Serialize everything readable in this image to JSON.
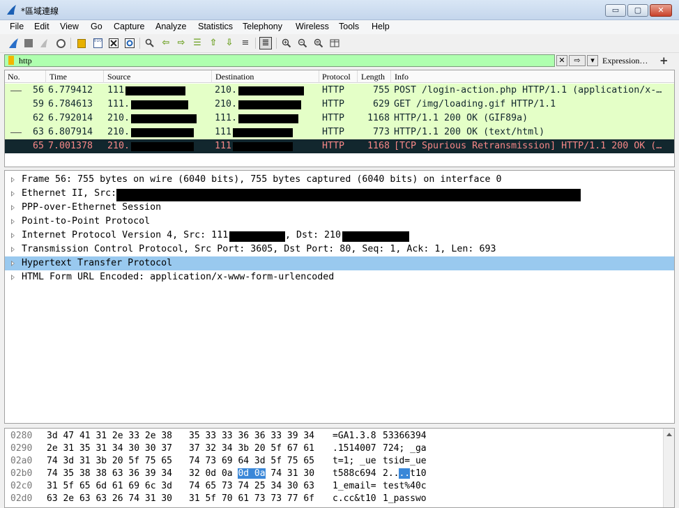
{
  "window": {
    "title": "*區域連線",
    "minimize_label": "▭",
    "maximize_label": "▢",
    "close_label": "✕"
  },
  "menu": [
    "File",
    "Edit",
    "View",
    "Go",
    "Capture",
    "Analyze",
    "Statistics",
    "Telephony",
    "Wireless",
    "Tools",
    "Help"
  ],
  "filter": {
    "value": "http",
    "expression_label": "Expression…",
    "plus_label": "+",
    "clear_label": "✕",
    "apply_label": "⇨",
    "dropdown_label": "▾"
  },
  "packet_list": {
    "columns": [
      "No.",
      "Time",
      "Source",
      "Destination",
      "Protocol",
      "Length",
      "Info"
    ],
    "rows": [
      {
        "no": "56",
        "time": "6.779412",
        "source": "111",
        "destination": "210.",
        "protocol": "HTTP",
        "length": "755",
        "info": "POST /login-action.php HTTP/1.1  (application/x-…",
        "bg": "#e4ffc7",
        "fg": "#12272e"
      },
      {
        "no": "59",
        "time": "6.784613",
        "source": "111.",
        "destination": "210.",
        "protocol": "HTTP",
        "length": "629",
        "info": "GET /img/loading.gif HTTP/1.1",
        "bg": "#e4ffc7",
        "fg": "#12272e"
      },
      {
        "no": "62",
        "time": "6.792014",
        "source": "210.",
        "destination": "111.",
        "protocol": "HTTP",
        "length": "1168",
        "info": "HTTP/1.1 200 OK  (GIF89a)",
        "bg": "#e4ffc7",
        "fg": "#12272e"
      },
      {
        "no": "63",
        "time": "6.807914",
        "source": "210.",
        "destination": "111",
        "protocol": "HTTP",
        "length": "773",
        "info": "HTTP/1.1 200 OK  (text/html)",
        "bg": "#e4ffc7",
        "fg": "#12272e"
      },
      {
        "no": "65",
        "time": "7.001378",
        "source": "210.",
        "destination": "111",
        "protocol": "HTTP",
        "length": "1168",
        "info": "[TCP Spurious Retransmission] HTTP/1.1 200 OK  (…",
        "bg": "#12272e",
        "fg": "#f78787"
      }
    ]
  },
  "details": [
    "Frame 56: 755 bytes on wire (6040 bits), 755 bytes captured (6040 bits) on interface 0",
    "Ethernet II, Src:",
    "PPP-over-Ethernet Session",
    "Point-to-Point Protocol",
    "Internet Protocol Version 4, Src: 111",
    "Transmission Control Protocol, Src Port: 3605, Dst Port: 80, Seq: 1, Ack: 1, Len: 693",
    "Hypertext Transfer Protocol",
    "HTML Form URL Encoded: application/x-www-form-urlencoded"
  ],
  "ipv4_dst_label": ", Dst: 210",
  "bytes": [
    {
      "offset": "0280",
      "hex1": "3d 47 41 31 2e 33 2e 38",
      "hex2": "35 33 33 36 36 33 39 34",
      "ascii1": "=GA1.3.8",
      "ascii2": "53366394"
    },
    {
      "offset": "0290",
      "hex1": "2e 31 35 31 34 30 30 37",
      "hex2": "37 32 34 3b 20 5f 67 61",
      "ascii1": ".1514007",
      "ascii2": "724; _ga"
    },
    {
      "offset": "02a0",
      "hex1": "74 3d 31 3b 20 5f 75 65",
      "hex2": "74 73 69 64 3d 5f 75 65",
      "ascii1": "t=1; _ue",
      "ascii2": "tsid=_ue"
    },
    {
      "offset": "02b0",
      "hex1": "74 35 38 38 63 36 39 34",
      "hex2_a": "32 0d 0a ",
      "hex2_hl": "0d 0a",
      "hex2_b": " 74 31 30",
      "ascii1": "t588c694",
      "ascii2_a": "2..",
      "ascii2_hl": "..",
      "ascii2_b": "t10"
    },
    {
      "offset": "02c0",
      "hex1": "31 5f 65 6d 61 69 6c 3d",
      "hex2": "74 65 73 74 25 34 30 63",
      "ascii1": "1_email=",
      "ascii2": "test%40c"
    },
    {
      "offset": "02d0",
      "hex1": "63 2e 63 63 26 74 31 30",
      "hex2": "31 5f 70 61 73 73 77 6f",
      "ascii1": "c.cc&t10",
      "ascii2": "1_passwo"
    }
  ],
  "colors": {
    "filter_ok": "#afffaf",
    "selected_detail": "#99c9ef",
    "bytes_highlight": "#3a87d8"
  }
}
